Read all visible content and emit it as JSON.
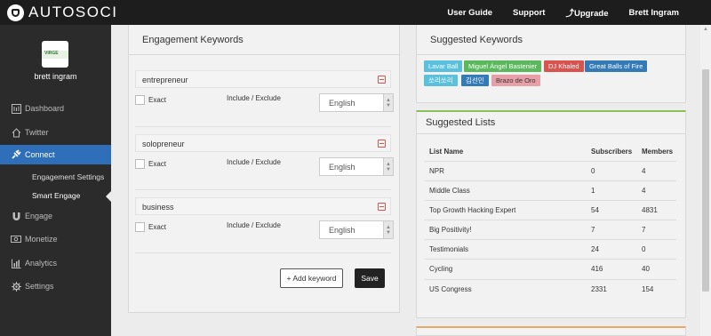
{
  "app": {
    "logo_text": "AUTOSOCI",
    "nav": [
      "User Guide",
      "Support",
      "Upgrade",
      "Brett Ingram"
    ]
  },
  "sidebar": {
    "username": "brett ingram",
    "avatar_text": "VIRGE",
    "items": [
      {
        "label": "Dashboard",
        "icon": "dashboard-icon"
      },
      {
        "label": "Twitter",
        "icon": "home-icon"
      },
      {
        "label": "Connect",
        "icon": "connect-icon"
      },
      {
        "label": "Engage",
        "icon": "magnet-icon"
      },
      {
        "label": "Monetize",
        "icon": "money-icon"
      },
      {
        "label": "Analytics",
        "icon": "bar-chart-icon"
      },
      {
        "label": "Settings",
        "icon": "gear-icon"
      }
    ],
    "subitems": [
      "Engagement Settings",
      "Smart Engage"
    ]
  },
  "engagement": {
    "title": "Engagement Keywords",
    "keywords": [
      {
        "name": "entrepreneur",
        "exact_label": "Exact",
        "include_label": "Include / Exclude",
        "language": "English"
      },
      {
        "name": "solopreneur",
        "exact_label": "Exact",
        "include_label": "Include / Exclude",
        "language": "English"
      },
      {
        "name": "business",
        "exact_label": "Exact",
        "include_label": "Include / Exclude",
        "language": "English"
      }
    ],
    "add_label": "+ Add keyword",
    "save_label": "Save"
  },
  "suggested_keywords": {
    "title": "Suggested Keywords",
    "tags": [
      {
        "label": "Lavar Ball",
        "color": "#5bc0de"
      },
      {
        "label": "Miguel Ángel Bastenier",
        "color": "#5cb85c"
      },
      {
        "label": "DJ Khaled",
        "color": "#d9534f"
      },
      {
        "label": "Great Balls of Fire",
        "color": "#337ab7"
      },
      {
        "label": "쏘리쏘리",
        "color": "#5bc0de"
      },
      {
        "label": "김선민",
        "color": "#337ab7"
      },
      {
        "label": "Brazo de Oro",
        "color": "#e8a0a8"
      }
    ]
  },
  "suggested_lists": {
    "title": "Suggested Lists",
    "headers": [
      "List Name",
      "Subscribers",
      "Members"
    ],
    "rows": [
      [
        "NPR",
        "0",
        "4"
      ],
      [
        "Middle Class",
        "1",
        "4"
      ],
      [
        "Top Growth Hacking Expert",
        "54",
        "4831"
      ],
      [
        "Big Positivity!",
        "7",
        "7"
      ],
      [
        "Testimonials",
        "24",
        "0"
      ],
      [
        "Cycling",
        "416",
        "40"
      ],
      [
        "US Congress",
        "2331",
        "154"
      ]
    ]
  }
}
